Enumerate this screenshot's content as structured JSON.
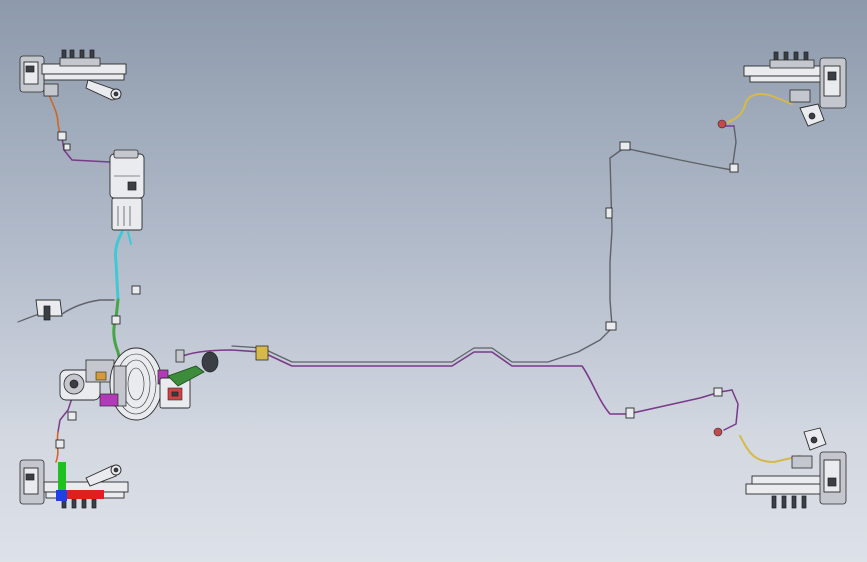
{
  "colors": {
    "background_top": "#8d9aab",
    "background_bottom": "#dde1e8",
    "brake_line_purple": "#7a3a8a",
    "brake_line_grey": "#5f6268",
    "reservoir_hose_cyan": "#3fc9d6",
    "supply_hose_green": "#47a447",
    "flex_hose_yellow": "#d7b94a",
    "flex_hose_orange": "#c96a2b",
    "abs_bracket_magenta": "#b23ab8",
    "triad_x_red": "#e02020",
    "triad_y_green": "#20c020",
    "triad_z_blue": "#2040e0"
  },
  "parts": [
    {
      "id": "front-left-brake-assembly",
      "icon": "disc-brake-icon"
    },
    {
      "id": "front-right-brake-assembly",
      "icon": "disc-brake-icon"
    },
    {
      "id": "rear-left-brake-assembly",
      "icon": "disc-brake-icon"
    },
    {
      "id": "rear-right-brake-assembly",
      "icon": "disc-brake-icon"
    },
    {
      "id": "fluid-reservoir",
      "icon": "reservoir-icon"
    },
    {
      "id": "brake-booster",
      "icon": "booster-icon"
    },
    {
      "id": "master-cylinder",
      "icon": "cylinder-icon"
    },
    {
      "id": "abs-module",
      "icon": "module-icon"
    },
    {
      "id": "brake-pedal",
      "icon": "pedal-icon"
    }
  ]
}
